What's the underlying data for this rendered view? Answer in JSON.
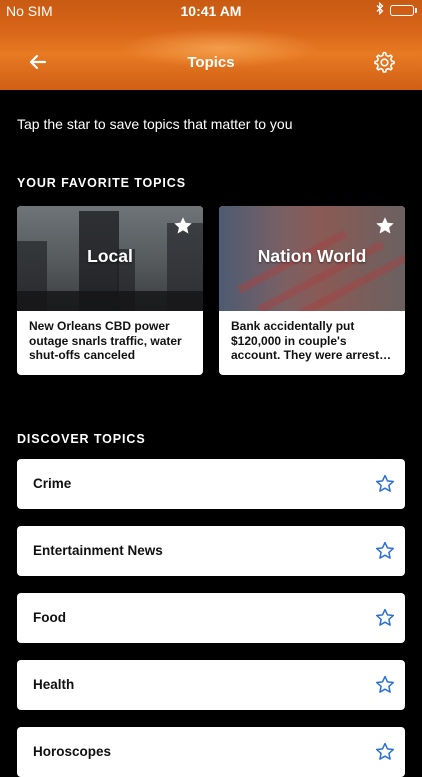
{
  "status_bar": {
    "carrier": "No SIM",
    "time": "10:41 AM",
    "battery_color": "#4cd964"
  },
  "nav": {
    "title": "Topics",
    "back_icon": "arrow-left-icon",
    "settings_icon": "gear-icon"
  },
  "intro_text": "Tap the star to save topics that matter to you",
  "favorites": {
    "heading": "YOUR FAVORITE TOPICS",
    "cards": [
      {
        "title": "Local",
        "headline_lines": [
          "New Orleans CBD power",
          "outage snarls traffic, water",
          "shut-offs canceled"
        ]
      },
      {
        "title": "Nation World",
        "headline_lines": [
          "Bank accidentally put",
          "$120,000 in couple's",
          "account. They were arreste..."
        ]
      }
    ]
  },
  "discover": {
    "heading": "DISCOVER TOPICS",
    "topics": [
      {
        "label": "Crime"
      },
      {
        "label": "Entertainment News"
      },
      {
        "label": "Food"
      },
      {
        "label": "Health"
      },
      {
        "label": "Horoscopes"
      }
    ]
  },
  "colors": {
    "accent": "#e0701d",
    "star_outline": "#2a6fd6",
    "background": "#000000"
  }
}
